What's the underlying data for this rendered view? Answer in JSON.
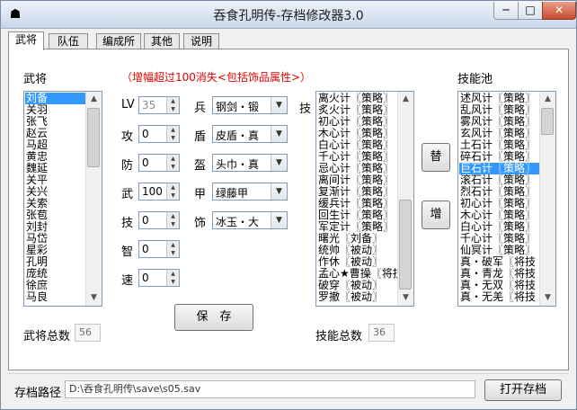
{
  "window": {
    "title": "吞食孔明传-存档修改器3.0",
    "icon": "app-icon",
    "controls": {
      "minimize": "─",
      "maximize": "□",
      "close": "✕"
    }
  },
  "tabs": [
    "武将",
    "队伍",
    "编成所",
    "其他",
    "说明"
  ],
  "general_panel": {
    "heading": "武将",
    "generals": [
      "刘备",
      "关羽",
      "张飞",
      "赵云",
      "马超",
      "黄忠",
      "魏延",
      "关平",
      "关兴",
      "关索",
      "张苞",
      "刘封",
      "马岱",
      "星彩",
      "孔明",
      "庞统",
      "徐庶",
      "马良"
    ],
    "total_label": "武将总数",
    "total_value": "56"
  },
  "notice": "（增幅超过100消失<包括饰品属性>）",
  "stats": [
    {
      "label": "LV",
      "value": "35",
      "disabled": true
    },
    {
      "label": "攻",
      "value": "0"
    },
    {
      "label": "防",
      "value": "0"
    },
    {
      "label": "武",
      "value": "100"
    },
    {
      "label": "技",
      "value": "0"
    },
    {
      "label": "智",
      "value": "0"
    },
    {
      "label": "速",
      "value": "0"
    }
  ],
  "equipment": [
    {
      "label": "兵",
      "value": "钢剑・锻"
    },
    {
      "label": "盾",
      "value": "皮盾・真"
    },
    {
      "label": "盔",
      "value": "头巾・真"
    },
    {
      "label": "甲",
      "value": "绿藤甲"
    },
    {
      "label": "饰",
      "value": "冰玉・大"
    }
  ],
  "save_button": "保　存",
  "skills": {
    "label": "技",
    "items": [
      "离火计〖策略〗",
      "炙火计〖策略〗",
      "初心计〖策略〗",
      "木心计〖策略〗",
      "白心计〖策略〗",
      "千心计〖策略〗",
      "忌心计〖策略〗",
      "离间计〖策略〗",
      "复渐计〖策略〗",
      "缓兵计〖策略〗",
      "回生计〖策略〗",
      "军定计〖策略〗",
      "曙光〖刘备〗",
      "统帅〖被动〗",
      "作休〖被动〗",
      "孟心★曹操〖将技",
      "破穿〖被动〗",
      "罗撤〖被动〗"
    ],
    "total_label": "技能总数",
    "total_value": "36"
  },
  "replace_button": "替",
  "add_button": "增",
  "skill_pool": {
    "heading": "技能池",
    "items": [
      "述风计〖策略〗",
      "乱风计〖策略〗",
      "雾风计〖策略〗",
      "玄风计〖策略〗",
      "土石计〖策略〗",
      "碎石计〖策略〗",
      "巨石计〖策略〗",
      "滚石计〖策略〗",
      "烈石计〖策略〗",
      "初心计〖策略〗",
      "木心计〖策略〗",
      "白心计〖策略〗",
      "千心计〖策略〗",
      "仙冥计〖策略〗",
      "真・破军〖将技",
      "真・青龙〖将技",
      "真・无双〖将技",
      "真・无羌〖将技"
    ],
    "selected_index": 6
  },
  "footer": {
    "path_label": "存档路径",
    "path_value": "D:\\吞食孔明传\\save\\s05.sav",
    "open_button": "打开存档"
  },
  "colors": {
    "notice": "#e00000",
    "selection": "#3399ff"
  }
}
